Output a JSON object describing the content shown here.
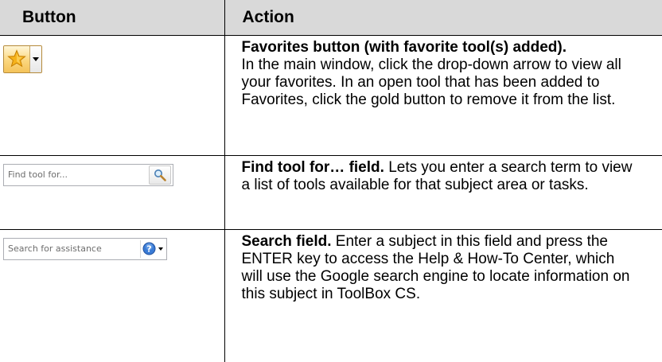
{
  "table": {
    "headers": {
      "button": "Button",
      "action": "Action"
    },
    "rows": [
      {
        "icon": "favorites-star-dropdown-icon",
        "title": "Favorites button (with favorite tool(s) added).",
        "description": "In the main window, click the drop-down arrow to view all your favorites. In an open tool that has been added to Favorites, click the gold button to remove it from the list."
      },
      {
        "field_placeholder": "Find tool for...",
        "icon": "magnifier-icon",
        "title": "Find tool for… field.",
        "description": "Lets you enter a search term to view a list of tools available for that subject area or tasks."
      },
      {
        "field_placeholder": "Search for assistance",
        "icon": "help-question-icon",
        "title": "Search field.",
        "description": "Enter a subject in this field and press the ENTER key to access the Help & How-To Center, which will use the Google search engine to locate information on this subject in ToolBox CS."
      }
    ]
  },
  "colors": {
    "header_background": "#d9d9d9",
    "star_gold": "#f5b21b",
    "help_blue": "#3a7bd5"
  }
}
